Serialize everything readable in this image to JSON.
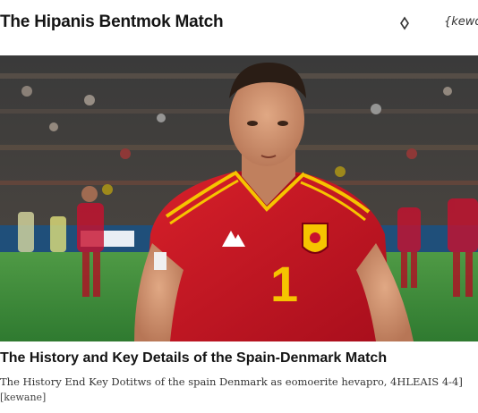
{
  "header": {
    "site_title": "The Hipanis Bentmok Match",
    "search_icon": "search-icon",
    "tag_label": "{kewor"
  },
  "hero": {
    "description_colors": {
      "jersey_red": "#c8102e",
      "trim_yellow": "#f6c400",
      "pitch_green": "#3a8a3a",
      "crowd_dark": "#2b2a2a"
    },
    "jersey_number": "1"
  },
  "article": {
    "title": "The History and Key Details of the Spain-Denmark Match",
    "summary": "The History End Key Dotitws of the spain Denmark as eomoerite hevapro, 4HLEAIS 4-4]",
    "keyword": "[kewane]"
  }
}
